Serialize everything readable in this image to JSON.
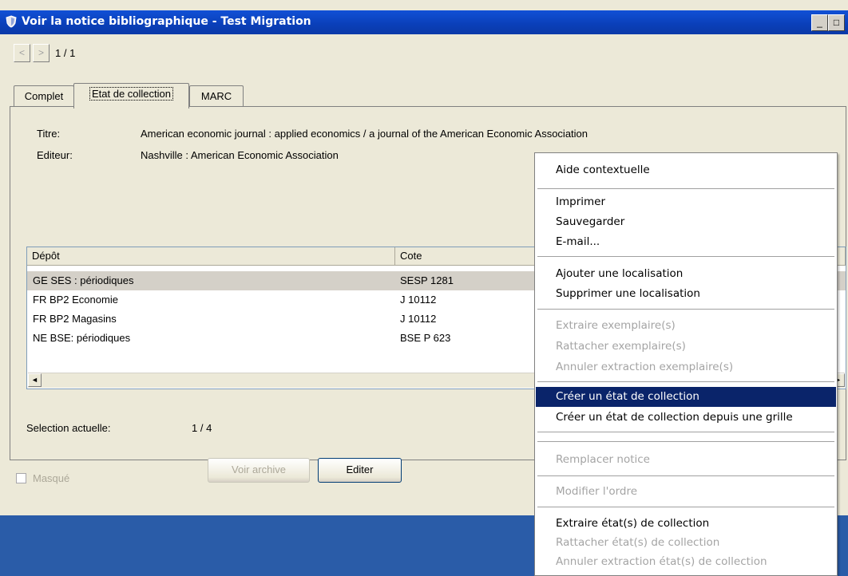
{
  "window": {
    "title": "Voir la notice bibliographique - Test Migration",
    "minimize": "_",
    "maximize": "□"
  },
  "nav": {
    "prev": "<",
    "next": ">",
    "counter": "1 / 1"
  },
  "tabs": [
    "Complet",
    "Etat de collection",
    "MARC"
  ],
  "record": {
    "titre_label": "Titre:",
    "titre_value": "American economic journal : applied economics / a journal of the American Economic Association",
    "editeur_label": "Editeur:",
    "editeur_value": "Nashville : American Economic Association"
  },
  "table": {
    "headers": [
      "Dépôt",
      "Cote"
    ],
    "rows": [
      {
        "depot": "GE SES : périodiques",
        "cote": "SESP 1281"
      },
      {
        "depot": "FR BP2 Economie",
        "cote": "J 10112"
      },
      {
        "depot": "FR BP2 Magasins",
        "cote": "J 10112"
      },
      {
        "depot": "NE BSE: périodiques",
        "cote": "BSE P 623"
      }
    ],
    "scroll_left": "◄",
    "scroll_right": "►"
  },
  "selection": {
    "label": "Selection actuelle:",
    "value": "1 / 4"
  },
  "bottom": {
    "masque_label": "Masqué",
    "voir_archive": "Voir archive",
    "editer": "Editer"
  },
  "context_menu": {
    "items": [
      {
        "label": "Aide contextuelle",
        "enabled": true
      },
      {
        "label": "Imprimer",
        "enabled": true
      },
      {
        "label": "Sauvegarder",
        "enabled": true
      },
      {
        "label": "E-mail...",
        "enabled": true
      },
      {
        "label": "Ajouter une localisation",
        "enabled": true
      },
      {
        "label": "Supprimer une localisation",
        "enabled": true
      },
      {
        "label": "Extraire exemplaire(s)",
        "enabled": false
      },
      {
        "label": "Rattacher exemplaire(s)",
        "enabled": false
      },
      {
        "label": "Annuler extraction exemplaire(s)",
        "enabled": false
      },
      {
        "label": "Créer un état de collection",
        "enabled": true,
        "highlighted": true
      },
      {
        "label": "Créer un état de collection depuis une grille",
        "enabled": true
      },
      {
        "label": "Remplacer notice",
        "enabled": false
      },
      {
        "label": "Modifier l'ordre",
        "enabled": false
      },
      {
        "label": "Extraire état(s) de collection",
        "enabled": true
      },
      {
        "label": "Rattacher état(s) de collection",
        "enabled": false
      },
      {
        "label": "Annuler extraction état(s) de collection",
        "enabled": false
      }
    ]
  },
  "colors": {
    "title_bar": "#0a3fb8",
    "menu_highlight": "#0a246a",
    "desktop": "#2a5ca8",
    "selected_row": "#d4d0c8"
  }
}
